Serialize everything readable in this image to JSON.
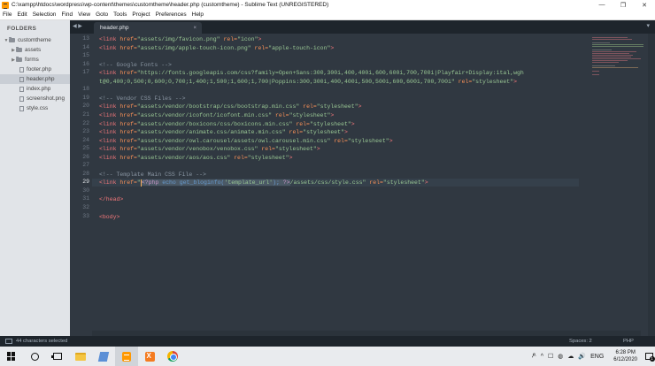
{
  "window": {
    "title": "C:\\xampp\\htdocs\\wordpress\\wp-content\\themes\\customtheme\\header.php (customtheme) - Sublime Text (UNREGISTERED)",
    "controls": [
      "—",
      "❐",
      "✕"
    ]
  },
  "menu": [
    "File",
    "Edit",
    "Selection",
    "Find",
    "View",
    "Goto",
    "Tools",
    "Project",
    "Preferences",
    "Help"
  ],
  "sidebar": {
    "heading": "FOLDERS",
    "items": [
      {
        "label": "customtheme",
        "type": "folder",
        "arrow": "▼"
      },
      {
        "label": "assets",
        "type": "folder",
        "arrow": "▶"
      },
      {
        "label": "forms",
        "type": "folder",
        "arrow": "▶"
      },
      {
        "label": "footer.php",
        "type": "file"
      },
      {
        "label": "header.php",
        "type": "file",
        "selected": true
      },
      {
        "label": "index.php",
        "type": "file"
      },
      {
        "label": "screenshot.png",
        "type": "file"
      },
      {
        "label": "style.css",
        "type": "file"
      }
    ]
  },
  "tabs": {
    "nav": "◀ ▶",
    "active_label": "header.php",
    "close": "×",
    "dropdown": "▾"
  },
  "code": {
    "line_numbers": [
      "13",
      "14",
      "15",
      "16",
      "17",
      "",
      "18",
      "19",
      "20",
      "21",
      "22",
      "23",
      "24",
      "25",
      "26",
      "27",
      "28",
      "29",
      "30",
      "31",
      "32",
      "33"
    ],
    "active_line": "29",
    "lines": [
      {
        "n": "13",
        "segs": [
          [
            "tag",
            "<link "
          ],
          [
            "attr",
            "href="
          ],
          [
            "str",
            "\"assets/img/favicon.png\""
          ],
          [
            "attr",
            " rel="
          ],
          [
            "str",
            "\"icon\""
          ],
          [
            "tag",
            ">"
          ]
        ]
      },
      {
        "n": "14",
        "segs": [
          [
            "tag",
            "<link "
          ],
          [
            "attr",
            "href="
          ],
          [
            "str",
            "\"assets/img/apple-touch-icon.png\""
          ],
          [
            "attr",
            " rel="
          ],
          [
            "str",
            "\"apple-touch-icon\""
          ],
          [
            "tag",
            ">"
          ]
        ]
      },
      {
        "n": "15",
        "segs": []
      },
      {
        "n": "16",
        "segs": [
          [
            "cmt",
            "<!-- Google Fonts -->"
          ]
        ]
      },
      {
        "n": "17",
        "segs": [
          [
            "tag",
            "<link "
          ],
          [
            "attr",
            "href="
          ],
          [
            "str",
            "\"https://fonts.googleapis.com/css?family=Open+Sans:300,300i,400,400i,600,600i,700,700i|Playfair+Display:ital,wgh"
          ]
        ]
      },
      {
        "n": "",
        "segs": [
          [
            "str",
            "t@0,400;0,500;0,600;0,700;1,400;1,500;1,600;1,700|Poppins:300,300i,400,400i,500,500i,600,600i,700,700i\""
          ],
          [
            "attr",
            " rel="
          ],
          [
            "str",
            "\"stylesheet\""
          ],
          [
            "tag",
            ">"
          ]
        ]
      },
      {
        "n": "18",
        "segs": []
      },
      {
        "n": "19",
        "segs": [
          [
            "cmt",
            "<!-- Vendor CSS Files -->"
          ]
        ]
      },
      {
        "n": "20",
        "segs": [
          [
            "tag",
            "<link "
          ],
          [
            "attr",
            "href="
          ],
          [
            "str",
            "\"assets/vendor/bootstrap/css/bootstrap.min.css\""
          ],
          [
            "attr",
            " rel="
          ],
          [
            "str",
            "\"stylesheet\""
          ],
          [
            "tag",
            ">"
          ]
        ]
      },
      {
        "n": "21",
        "segs": [
          [
            "tag",
            "<link "
          ],
          [
            "attr",
            "href="
          ],
          [
            "str",
            "\"assets/vendor/icofont/icofont.min.css\""
          ],
          [
            "attr",
            " rel="
          ],
          [
            "str",
            "\"stylesheet\""
          ],
          [
            "tag",
            ">"
          ]
        ]
      },
      {
        "n": "22",
        "segs": [
          [
            "tag",
            "<link "
          ],
          [
            "attr",
            "href="
          ],
          [
            "str",
            "\"assets/vendor/boxicons/css/boxicons.min.css\""
          ],
          [
            "attr",
            " rel="
          ],
          [
            "str",
            "\"stylesheet\""
          ],
          [
            "tag",
            ">"
          ]
        ]
      },
      {
        "n": "23",
        "segs": [
          [
            "tag",
            "<link "
          ],
          [
            "attr",
            "href="
          ],
          [
            "str",
            "\"assets/vendor/animate.css/animate.min.css\""
          ],
          [
            "attr",
            " rel="
          ],
          [
            "str",
            "\"stylesheet\""
          ],
          [
            "tag",
            ">"
          ]
        ]
      },
      {
        "n": "24",
        "segs": [
          [
            "tag",
            "<link "
          ],
          [
            "attr",
            "href="
          ],
          [
            "str",
            "\"assets/vendor/owl.carousel/assets/owl.carousel.min.css\""
          ],
          [
            "attr",
            " rel="
          ],
          [
            "str",
            "\"stylesheet\""
          ],
          [
            "tag",
            ">"
          ]
        ]
      },
      {
        "n": "25",
        "segs": [
          [
            "tag",
            "<link "
          ],
          [
            "attr",
            "href="
          ],
          [
            "str",
            "\"assets/vendor/venobox/venobox.css\""
          ],
          [
            "attr",
            " rel="
          ],
          [
            "str",
            "\"stylesheet\""
          ],
          [
            "tag",
            ">"
          ]
        ]
      },
      {
        "n": "26",
        "segs": [
          [
            "tag",
            "<link "
          ],
          [
            "attr",
            "href="
          ],
          [
            "str",
            "\"assets/vendor/aos/aos.css\""
          ],
          [
            "attr",
            " rel="
          ],
          [
            "str",
            "\"stylesheet\""
          ],
          [
            "tag",
            ">"
          ]
        ]
      },
      {
        "n": "27",
        "segs": []
      },
      {
        "n": "28",
        "segs": [
          [
            "cmt",
            "<!-- Template Main CSS File -->"
          ]
        ]
      },
      {
        "n": "29",
        "segs": [
          [
            "tag",
            "<link "
          ],
          [
            "attr",
            "href="
          ],
          [
            "str",
            "\""
          ],
          [
            "cursor",
            ""
          ],
          [
            "phpsel",
            "<?php "
          ],
          [
            "fnsel",
            "echo get_bloginfo("
          ],
          [
            "strsel",
            "'template_url'"
          ],
          [
            "fnsel",
            "); "
          ],
          [
            "phpsel",
            "?>"
          ],
          [
            "str",
            "/assets/css/style.css\""
          ],
          [
            "attr",
            " rel="
          ],
          [
            "str",
            "\"stylesheet\""
          ],
          [
            "tag",
            ">"
          ]
        ]
      },
      {
        "n": "30",
        "segs": []
      },
      {
        "n": "31",
        "segs": [
          [
            "tag",
            "</head>"
          ]
        ]
      },
      {
        "n": "32",
        "segs": []
      },
      {
        "n": "33",
        "segs": [
          [
            "tag",
            "<body>"
          ]
        ]
      }
    ]
  },
  "status": {
    "selection": "44 characters selected",
    "spaces": "Spaces: 2",
    "syntax": "PHP"
  },
  "taskbar": {
    "tray_icons": [
      "ዶ",
      "^",
      "☐",
      "◍",
      "☁",
      "🔊",
      "ENG"
    ],
    "time": "6:28 PM",
    "date": "6/12/2020",
    "notifications": "1"
  }
}
